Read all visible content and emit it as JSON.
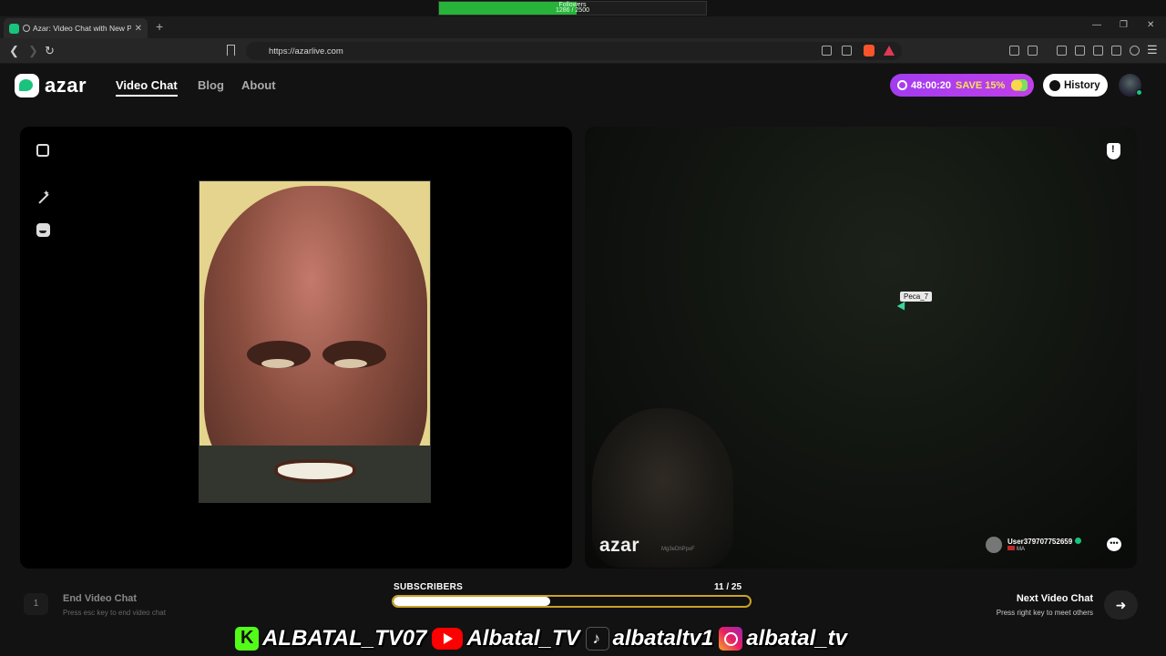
{
  "stream_overlay": {
    "followers_label": "Followers",
    "followers_count": "1286 / 2500",
    "followers_fraction": 0.514,
    "subscribers_label": "SUBSCRIBERS",
    "subscribers_count": "11 / 25",
    "subscribers_fraction": 0.44,
    "socials": [
      {
        "icon": "kick-icon",
        "handle": "ALBATAL_TV07"
      },
      {
        "icon": "youtube-icon",
        "handle": "Albatal_TV"
      },
      {
        "icon": "tiktok-icon",
        "handle": "albataltv1"
      },
      {
        "icon": "instagram-icon",
        "handle": "albatal_tv"
      }
    ]
  },
  "browser": {
    "tab_title": "Azar: Video Chat with New Pe",
    "url": "https://azarlive.com"
  },
  "site": {
    "logo_text": "azar",
    "nav": [
      "Video Chat",
      "Blog",
      "About"
    ],
    "active_nav": "Video Chat",
    "promo_timer": "48:00:20",
    "promo_save": "SAVE 15%",
    "history_label": "History",
    "brand_color": "#19c37d",
    "promo_color": "#b63ef0"
  },
  "video": {
    "remote_cursor_name": "Peca_7",
    "watermark": "azar",
    "watermark_id": "Mg3eDhPpxF",
    "peer_username": "User379707752659",
    "peer_country": "MA"
  },
  "controls": {
    "end_key": "1",
    "end_title": "End Video Chat",
    "end_hint": "Press esc key to end video chat",
    "next_title": "Next Video Chat",
    "next_hint": "Press right key to meet others"
  }
}
